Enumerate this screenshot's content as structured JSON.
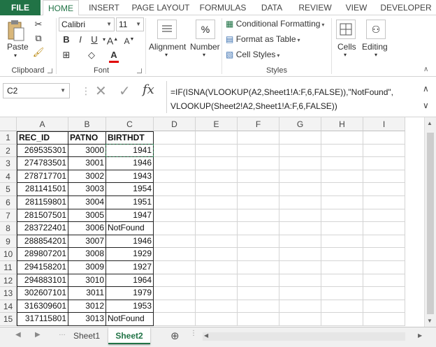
{
  "ribbon_tabs": [
    "FILE",
    "HOME",
    "INSERT",
    "PAGE LAYOUT",
    "FORMULAS",
    "DATA",
    "REVIEW",
    "VIEW",
    "DEVELOPER"
  ],
  "active_tab": "HOME",
  "clipboard": {
    "paste_label": "Paste",
    "group_label": "Clipboard"
  },
  "font": {
    "name": "Calibri",
    "size": "11",
    "bold": "B",
    "italic": "I",
    "underline": "U",
    "group_label": "Font",
    "font_color": "#e00000"
  },
  "alignment": {
    "label": "Alignment"
  },
  "number": {
    "label": "Number",
    "symbol": "%"
  },
  "styles": {
    "conditional_formatting": "Conditional Formatting",
    "format_as_table": "Format as Table",
    "cell_styles": "Cell Styles",
    "group_label": "Styles"
  },
  "cells": {
    "label": "Cells"
  },
  "editing": {
    "label": "Editing"
  },
  "formula_bar": {
    "name_box": "C2",
    "fx": "fx",
    "formula_line1": "=IF(ISNA(VLOOKUP(A2,Sheet1!A:F,6,FALSE)),\"NotFound\",",
    "formula_line2": "VLOOKUP(Sheet2!A2,Sheet1!A:F,6,FALSE))"
  },
  "grid": {
    "columns": [
      "A",
      "B",
      "C",
      "D",
      "E",
      "F",
      "G",
      "H",
      "I"
    ],
    "rows": [
      "1",
      "2",
      "3",
      "4",
      "5",
      "6",
      "7",
      "8",
      "9",
      "10",
      "11",
      "12",
      "13",
      "14",
      "15"
    ],
    "headers": [
      "REC_ID",
      "PATNO",
      "BIRTHDT"
    ],
    "data": [
      [
        "269535301",
        "3000",
        "1941"
      ],
      [
        "274783501",
        "3001",
        "1946"
      ],
      [
        "278717701",
        "3002",
        "1943"
      ],
      [
        "281141501",
        "3003",
        "1954"
      ],
      [
        "281159801",
        "3004",
        "1951"
      ],
      [
        "281507501",
        "3005",
        "1947"
      ],
      [
        "283722401",
        "3006",
        "NotFound"
      ],
      [
        "288854201",
        "3007",
        "1946"
      ],
      [
        "289807201",
        "3008",
        "1929"
      ],
      [
        "294158201",
        "3009",
        "1927"
      ],
      [
        "294883101",
        "3010",
        "1964"
      ],
      [
        "302607101",
        "3011",
        "1979"
      ],
      [
        "316309601",
        "3012",
        "1953"
      ],
      [
        "317115801",
        "3013",
        "NotFound"
      ]
    ]
  },
  "sheets": [
    "Sheet1",
    "Sheet2"
  ],
  "active_sheet": "Sheet2",
  "accent_color": "#217346"
}
